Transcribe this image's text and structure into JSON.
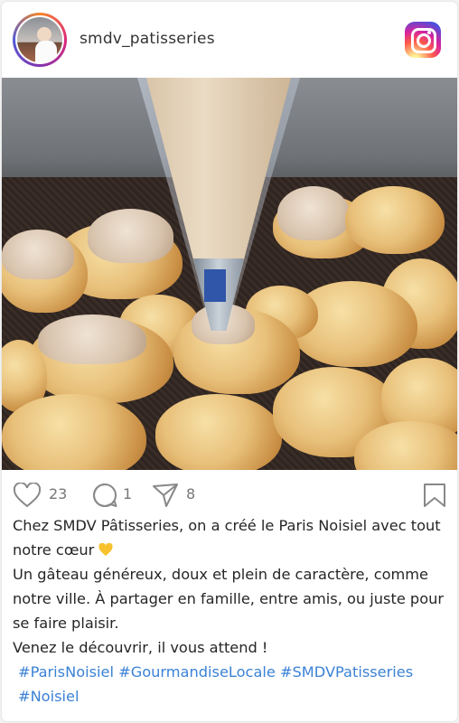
{
  "post": {
    "username": "smdv_patisseries",
    "avatar_icon": "avatar-chef-icon",
    "platform_icon": "instagram-logo-icon",
    "photo_alt": "choux-pastry-piping-photo"
  },
  "actions": {
    "likes": "23",
    "comments": "1",
    "shares": "8"
  },
  "caption": {
    "line1": "Chez SMDV Pâtisseries, on a créé le Paris Noisiel avec tout notre cœur",
    "line2": "Un gâteau généreux, doux et plein de caractère, comme notre ville. À partager en famille, entre amis, ou juste pour se faire plaisir.",
    "line3": "Venez le découvrir, il vous attend !",
    "hashtags": "#ParisNoisiel #GourmandiseLocale #SMDVPatisseries #Noisiel",
    "emoji": "yellow-heart-emoji"
  },
  "colors": {
    "hashtag": "#3b82d6",
    "icon_stroke": "#777777",
    "instagram_gradient": [
      "#fdf497",
      "#fd5949",
      "#d6249f",
      "#285AEB"
    ]
  }
}
